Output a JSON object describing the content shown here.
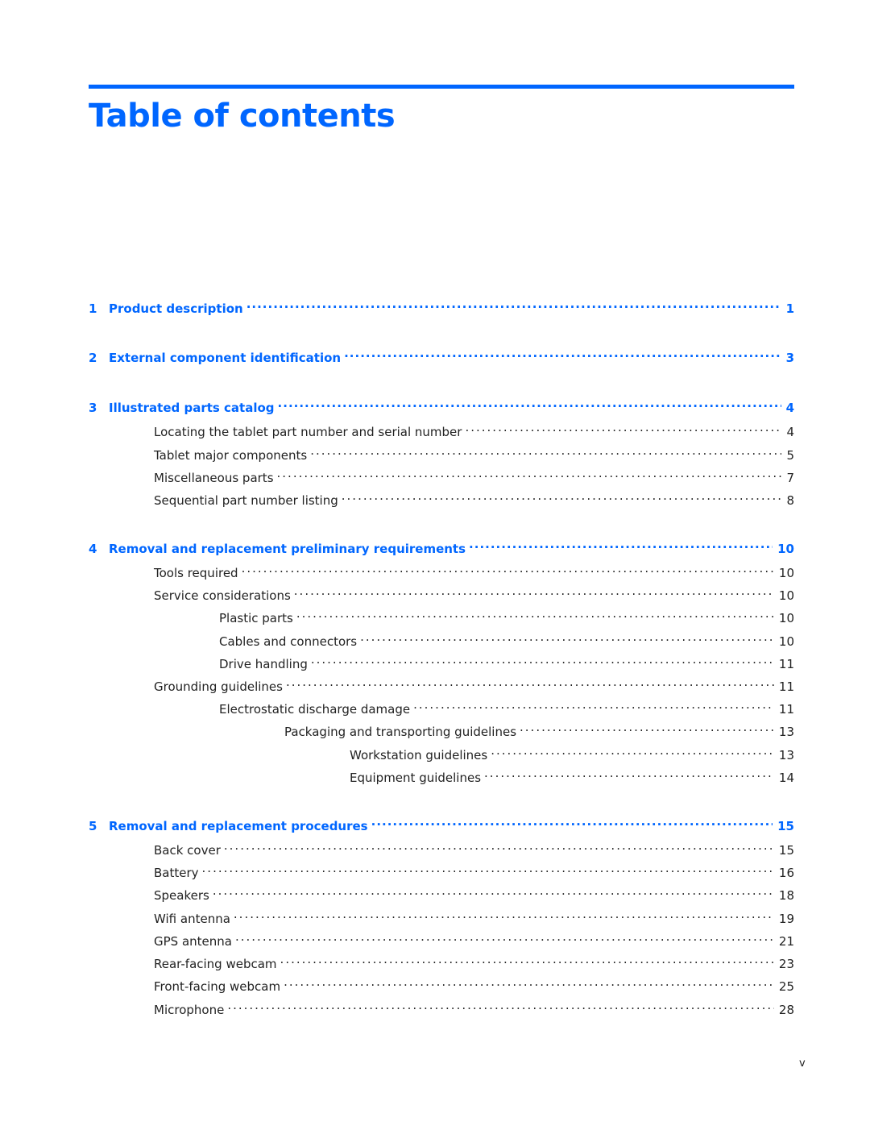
{
  "page": {
    "title": "Table of contents",
    "footer_page_number": "v",
    "accent_color": "#0066ff"
  },
  "toc": [
    {
      "level": 0,
      "number": "1",
      "label": "Product description",
      "page": "1"
    },
    {
      "level": 0,
      "number": "2",
      "label": "External component identification",
      "page": "3"
    },
    {
      "level": 0,
      "number": "3",
      "label": "Illustrated parts catalog",
      "page": "4"
    },
    {
      "level": 1,
      "label": "Locating the tablet part number and serial number",
      "page": "4"
    },
    {
      "level": 1,
      "label": "Tablet major components",
      "page": "5"
    },
    {
      "level": 1,
      "label": "Miscellaneous parts",
      "page": "7"
    },
    {
      "level": 1,
      "label": "Sequential part number listing",
      "page": "8"
    },
    {
      "level": 0,
      "number": "4",
      "label": "Removal and replacement preliminary requirements",
      "page": "10"
    },
    {
      "level": 1,
      "label": "Tools required",
      "page": "10"
    },
    {
      "level": 1,
      "label": "Service considerations",
      "page": "10"
    },
    {
      "level": 2,
      "label": "Plastic parts",
      "page": "10"
    },
    {
      "level": 2,
      "label": "Cables and connectors",
      "page": "10"
    },
    {
      "level": 2,
      "label": "Drive handling",
      "page": "11"
    },
    {
      "level": 1,
      "label": "Grounding guidelines",
      "page": "11"
    },
    {
      "level": 2,
      "label": "Electrostatic discharge damage",
      "page": "11"
    },
    {
      "level": 3,
      "label": "Packaging and transporting guidelines",
      "page": "13"
    },
    {
      "level": 4,
      "label": "Workstation guidelines",
      "page": "13"
    },
    {
      "level": 4,
      "label": "Equipment guidelines",
      "page": "14"
    },
    {
      "level": 0,
      "number": "5",
      "label": "Removal and replacement procedures",
      "page": "15"
    },
    {
      "level": 1,
      "label": "Back cover",
      "page": "15"
    },
    {
      "level": 1,
      "label": "Battery",
      "page": "16"
    },
    {
      "level": 1,
      "label": "Speakers",
      "page": "18"
    },
    {
      "level": 1,
      "label": "Wifi antenna",
      "page": "19"
    },
    {
      "level": 1,
      "label": "GPS antenna",
      "page": "21"
    },
    {
      "level": 1,
      "label": "Rear-facing webcam",
      "page": "23"
    },
    {
      "level": 1,
      "label": "Front-facing webcam",
      "page": "25"
    },
    {
      "level": 1,
      "label": "Microphone",
      "page": "28"
    }
  ]
}
